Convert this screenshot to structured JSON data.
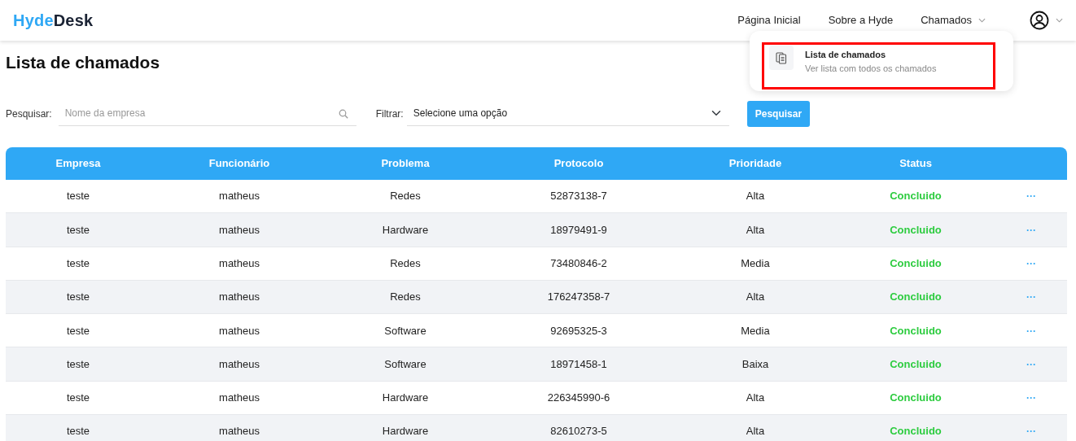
{
  "brand": {
    "part_1": "Hyde",
    "part_2": "Desk"
  },
  "nav": [
    {
      "label": "Página Inicial",
      "kind": "link"
    },
    {
      "label": "Sobre a Hyde",
      "kind": "link"
    },
    {
      "label": "Chamados",
      "kind": "dropdown",
      "expanded": true
    }
  ],
  "dropdown": {
    "title": "Lista de chamados",
    "subtitle": "Ver lista com todos os chamados",
    "highlighted": true
  },
  "page_title": "Lista de chamados",
  "search": {
    "label": "Pesquisar:",
    "placeholder": "Nome da empresa"
  },
  "filter": {
    "label": "Filtrar:",
    "value": "Selecione uma opção"
  },
  "search_button": "Pesquisar",
  "table": {
    "columns": [
      "Empresa",
      "Funcionário",
      "Problema",
      "Protocolo",
      "Prioridade",
      "Status"
    ],
    "rows": [
      {
        "cells": [
          "teste",
          "matheus",
          "Redes",
          "52873138-7",
          "Alta",
          "Concluido"
        ],
        "action": "···"
      },
      {
        "cells": [
          "teste",
          "matheus",
          "Hardware",
          "18979491-9",
          "Alta",
          "Concluido"
        ],
        "action": "···"
      },
      {
        "cells": [
          "teste",
          "matheus",
          "Redes",
          "73480846-2",
          "Media",
          "Concluido"
        ],
        "action": "···"
      },
      {
        "cells": [
          "teste",
          "matheus",
          "Redes",
          "176247358-7",
          "Alta",
          "Concluido"
        ],
        "action": "···"
      },
      {
        "cells": [
          "teste",
          "matheus",
          "Software",
          "92695325-3",
          "Media",
          "Concluido"
        ],
        "action": "···"
      },
      {
        "cells": [
          "teste",
          "matheus",
          "Software",
          "18971458-1",
          "Baixa",
          "Concluido"
        ],
        "action": "···"
      },
      {
        "cells": [
          "teste",
          "matheus",
          "Hardware",
          "226345990-6",
          "Alta",
          "Concluido"
        ],
        "action": "···"
      },
      {
        "cells": [
          "teste",
          "matheus",
          "Hardware",
          "82610273-5",
          "Alta",
          "Concluido"
        ],
        "action": "···"
      }
    ]
  }
}
